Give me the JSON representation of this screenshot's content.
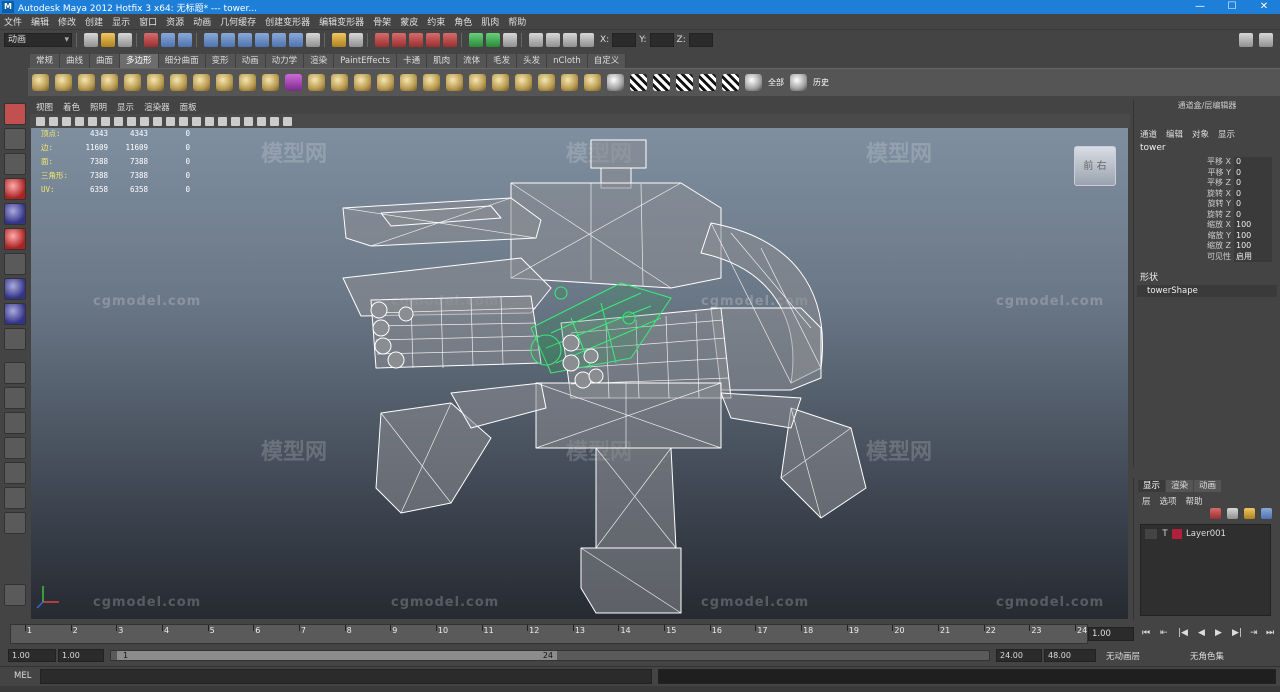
{
  "window": {
    "title": "Autodesk Maya 2012 Hotfix 3 x64: 无标题*   ---   tower..."
  },
  "menu": [
    "文件",
    "编辑",
    "修改",
    "创建",
    "显示",
    "窗口",
    "资源",
    "动画",
    "几何缓存",
    "创建变形器",
    "编辑变形器",
    "骨架",
    "蒙皮",
    "约束",
    "角色",
    "肌肉",
    "帮助"
  ],
  "status": {
    "mode_dropdown": "动画",
    "x_label": "X:",
    "y_label": "Y:",
    "z_label": "Z:"
  },
  "shelf_tabs": [
    "常规",
    "曲线",
    "曲面",
    "多边形",
    "细分曲面",
    "变形",
    "动画",
    "动力学",
    "渲染",
    "PaintEffects",
    "卡通",
    "肌肉",
    "流体",
    "毛发",
    "头发",
    "nCloth",
    "自定义"
  ],
  "shelf_active": "多边形",
  "shelf_labels": {
    "all": "全部",
    "history": "历史"
  },
  "panel_menu": [
    "视图",
    "着色",
    "照明",
    "显示",
    "渲染器",
    "面板"
  ],
  "hud": [
    {
      "label": "顶点:",
      "a": "4343",
      "b": "4343",
      "c": "0"
    },
    {
      "label": "边:",
      "a": "11609",
      "b": "11609",
      "c": "0"
    },
    {
      "label": "面:",
      "a": "7388",
      "b": "7388",
      "c": "0"
    },
    {
      "label": "三角形:",
      "a": "7388",
      "b": "7388",
      "c": "0"
    },
    {
      "label": "UV:",
      "a": "6358",
      "b": "6358",
      "c": "0"
    }
  ],
  "viewcube_label": "前 右",
  "watermarks": {
    "site": "cgmodel.com",
    "brand": "模型网"
  },
  "channel_box": {
    "header": "通道盒/层编辑器",
    "menu": [
      "通道",
      "编辑",
      "对象",
      "显示"
    ],
    "object": "tower",
    "attributes": [
      {
        "name": "平移 X",
        "value": "0"
      },
      {
        "name": "平移 Y",
        "value": "0"
      },
      {
        "name": "平移 Z",
        "value": "0"
      },
      {
        "name": "旋转 X",
        "value": "0"
      },
      {
        "name": "旋转 Y",
        "value": "0"
      },
      {
        "name": "旋转 Z",
        "value": "0"
      },
      {
        "name": "缩放 X",
        "value": "100"
      },
      {
        "name": "缩放 Y",
        "value": "100"
      },
      {
        "name": "缩放 Z",
        "value": "100"
      },
      {
        "name": "可见性",
        "value": "启用"
      }
    ],
    "shapes_label": "形状",
    "shape": "towerShape"
  },
  "layer_editor": {
    "tabs": [
      "显示",
      "渲染",
      "动画"
    ],
    "active_tab": "显示",
    "menu": [
      "层",
      "选项",
      "帮助"
    ],
    "layers": [
      {
        "vis": "",
        "type": "T",
        "color": "#b0203a",
        "name": "Layer001"
      }
    ]
  },
  "timeline": {
    "ticks": [
      "1",
      "2",
      "3",
      "4",
      "5",
      "6",
      "7",
      "8",
      "9",
      "10",
      "11",
      "12",
      "13",
      "14",
      "15",
      "16",
      "17",
      "18",
      "19",
      "20",
      "21",
      "22",
      "23",
      "24"
    ],
    "current": "1.00"
  },
  "range": {
    "start": "1.00",
    "playback_start": "1.00",
    "slider_start": "1",
    "slider_end": "24",
    "playback_end": "24.00",
    "end": "48.00",
    "anim_layer": "无动画层",
    "char_set": "无角色集"
  },
  "command": {
    "mel_label": "MEL"
  }
}
